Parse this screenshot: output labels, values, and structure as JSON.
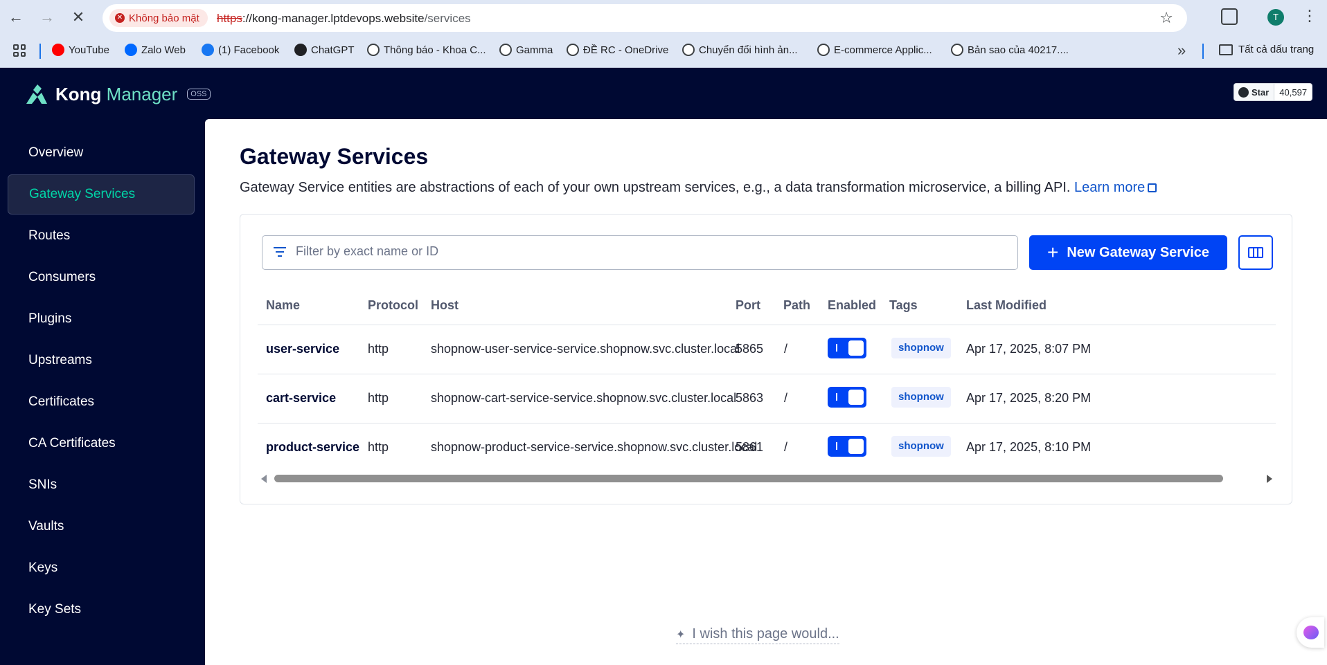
{
  "browser": {
    "security_chip": "Không bảo mật",
    "url_scheme": "https",
    "url_host": "://kong-manager.lptdevops.website",
    "url_path": "/services",
    "profile_initial": "T",
    "bookmarks": [
      {
        "label": "YouTube",
        "icon": "youtube-icon",
        "color": "#ff0000"
      },
      {
        "label": "Zalo Web",
        "icon": "zalo-icon",
        "color": "#0068ff"
      },
      {
        "label": "(1) Facebook",
        "icon": "facebook-icon",
        "color": "#1877f2"
      },
      {
        "label": "ChatGPT",
        "icon": "chatgpt-icon",
        "color": "#202124"
      },
      {
        "label": "Thông báo - Khoa C...",
        "icon": "globe-icon",
        "color": "#3c4043"
      },
      {
        "label": "Gamma",
        "icon": "globe-icon",
        "color": "#3c4043"
      },
      {
        "label": "ĐỀ RC - OneDrive",
        "icon": "globe-icon",
        "color": "#3c4043"
      },
      {
        "label": "Chuyển đổi hình ản...",
        "icon": "globe-icon",
        "color": "#3c4043"
      },
      {
        "label": "E-commerce Applic...",
        "icon": "globe-icon",
        "color": "#3c4043"
      },
      {
        "label": "Bản sao của 40217....",
        "icon": "globe-icon",
        "color": "#3c4043"
      }
    ],
    "all_bookmarks": "Tất cả dấu trang"
  },
  "app": {
    "logo_kong": "Kong",
    "logo_manager": "Manager",
    "logo_badge": "OSS",
    "github_star_label": "Star",
    "github_star_count": "40,597"
  },
  "sidebar": {
    "items": [
      {
        "label": "Overview",
        "active": false
      },
      {
        "label": "Gateway Services",
        "active": true
      },
      {
        "label": "Routes",
        "active": false
      },
      {
        "label": "Consumers",
        "active": false
      },
      {
        "label": "Plugins",
        "active": false
      },
      {
        "label": "Upstreams",
        "active": false
      },
      {
        "label": "Certificates",
        "active": false
      },
      {
        "label": "CA Certificates",
        "active": false
      },
      {
        "label": "SNIs",
        "active": false
      },
      {
        "label": "Vaults",
        "active": false
      },
      {
        "label": "Keys",
        "active": false
      },
      {
        "label": "Key Sets",
        "active": false
      }
    ]
  },
  "main": {
    "title": "Gateway Services",
    "description": "Gateway Service entities are abstractions of each of your own upstream services, e.g., a data transformation microservice, a billing API.",
    "learn_more": "Learn more",
    "filter_placeholder": "Filter by exact name or ID",
    "new_button": "New Gateway Service",
    "columns": [
      "Name",
      "Protocol",
      "Host",
      "Port",
      "Path",
      "Enabled",
      "Tags",
      "Last Modified"
    ],
    "rows": [
      {
        "name": "user-service",
        "protocol": "http",
        "host": "shopnow-user-service-service.shopnow.svc.cluster.local",
        "port": "5865",
        "path": "/",
        "enabled": true,
        "tag": "shopnow",
        "modified": "Apr 17, 2025, 8:07 PM"
      },
      {
        "name": "cart-service",
        "protocol": "http",
        "host": "shopnow-cart-service-service.shopnow.svc.cluster.local",
        "port": "5863",
        "path": "/",
        "enabled": true,
        "tag": "shopnow",
        "modified": "Apr 17, 2025, 8:20 PM"
      },
      {
        "name": "product-service",
        "protocol": "http",
        "host": "shopnow-product-service-service.shopnow.svc.cluster.local",
        "port": "5861",
        "path": "/",
        "enabled": true,
        "tag": "shopnow",
        "modified": "Apr 17, 2025, 8:10 PM"
      }
    ],
    "wish_text": "I wish this page would..."
  },
  "colors": {
    "sidebar_bg": "#000933",
    "active_text": "#00d7a8",
    "primary": "#0044f4",
    "link": "#1155cb"
  }
}
